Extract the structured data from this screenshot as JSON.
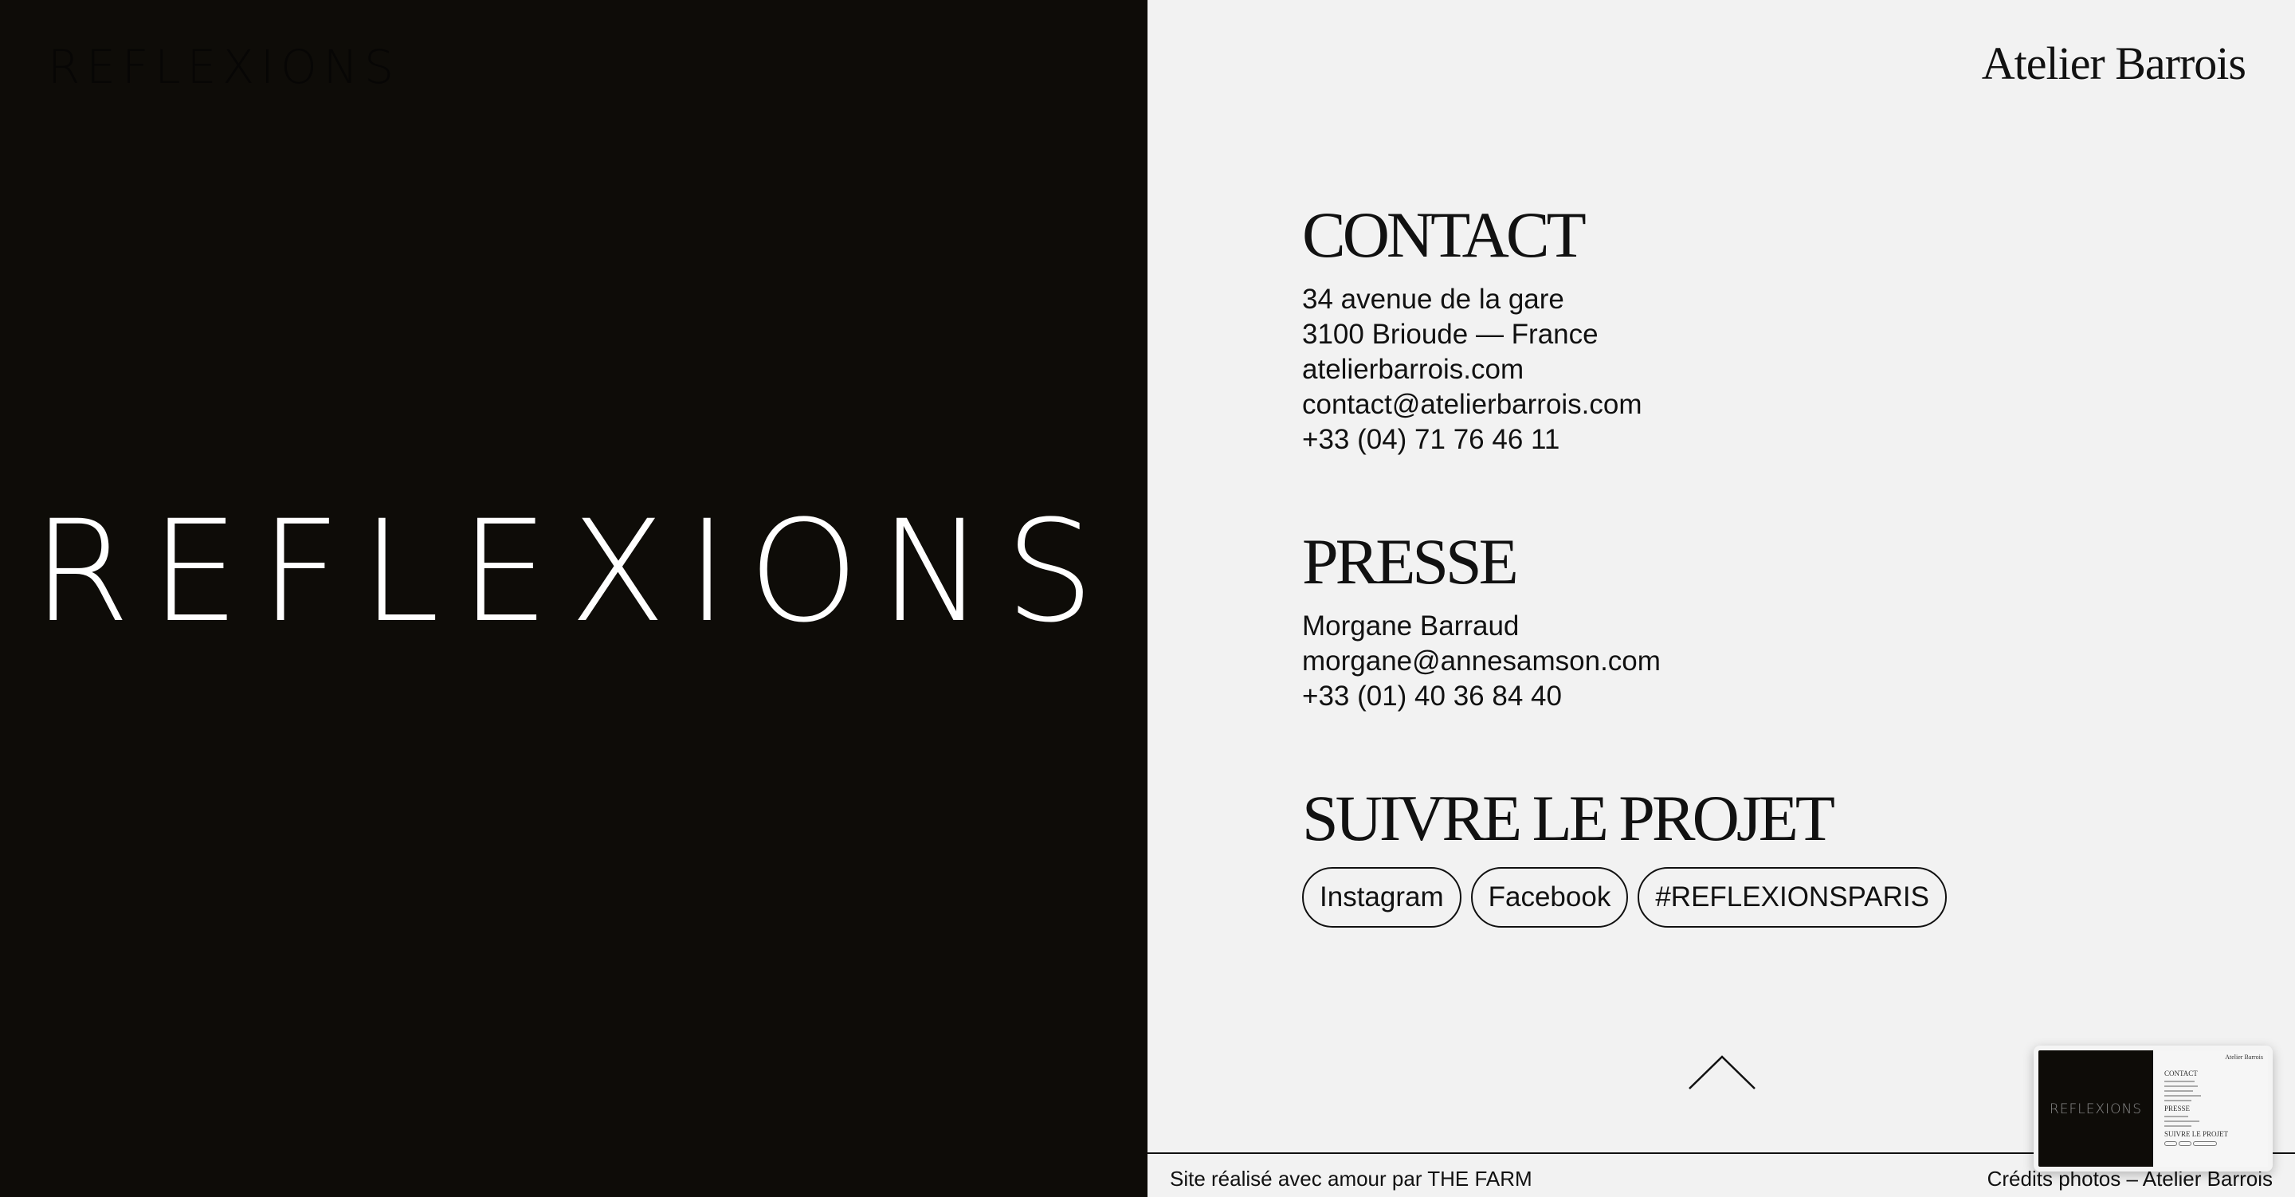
{
  "header": {
    "left_logo": "REFLEXIONS",
    "brand": "Atelier Barrois"
  },
  "hero": {
    "logo": "REFLEXIONS"
  },
  "contact": {
    "title": "CONTACT",
    "lines": [
      "34 avenue de la gare",
      "3100 Brioude — France",
      "atelierbarrois.com",
      "contact@atelierbarrois.com",
      "+33 (04) 71 76 46 11"
    ]
  },
  "presse": {
    "title": "PRESSE",
    "lines": [
      "Morgane Barraud",
      "morgane@annesamson.com",
      "+33 (01) 40 36 84 40"
    ]
  },
  "follow": {
    "title": "SUIVRE LE PROJET",
    "links": [
      "Instagram",
      "Facebook",
      "#REFLEXIONSPARIS"
    ]
  },
  "footer": {
    "credit_left": "Site réalisé avec amour par THE FARM",
    "credit_right": "Crédits photos – Atelier Barrois"
  },
  "thumbnail": {
    "logo": "REFLEXIONS",
    "brand": "Atelier Barrois",
    "contact": "CONTACT",
    "presse": "PRESSE",
    "follow": "SUIVRE LE PROJET"
  },
  "icons": {
    "scroll_top": "chevron-up-icon"
  },
  "colors": {
    "left_background": "#0e0c08",
    "right_background": "#f2f2f2",
    "text": "#111111",
    "hero_logo": "#ffffff"
  }
}
